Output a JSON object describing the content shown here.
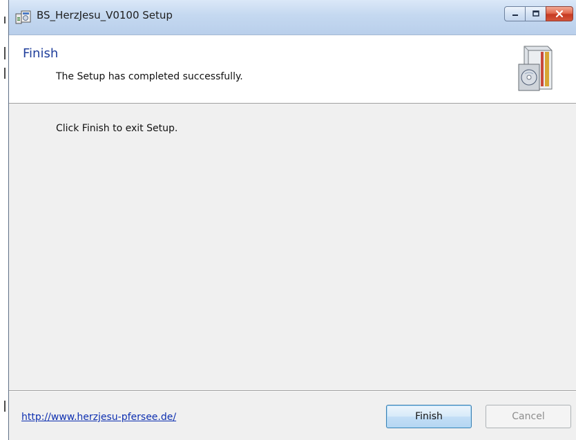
{
  "window": {
    "title": "BS_HerzJesu_V0100 Setup",
    "icon": "installer-icon"
  },
  "caption_buttons": {
    "minimize_icon": "minimize-icon",
    "maximize_icon": "maximize-icon",
    "close_icon": "close-icon"
  },
  "header": {
    "title": "Finish",
    "subtitle": "The Setup has completed successfully.",
    "graphic": "setup-box-graphic"
  },
  "body": {
    "text": "Click Finish to exit Setup."
  },
  "footer": {
    "link": "http://www.herzjesu-pfersee.de/",
    "finish_label": "Finish",
    "cancel_label": "Cancel",
    "cancel_enabled": false
  },
  "colors": {
    "titlebar": "#c4d8f0",
    "header_title": "#1f3e9b",
    "link": "#0d2fb0",
    "button_focus": "#3c7fb1"
  }
}
